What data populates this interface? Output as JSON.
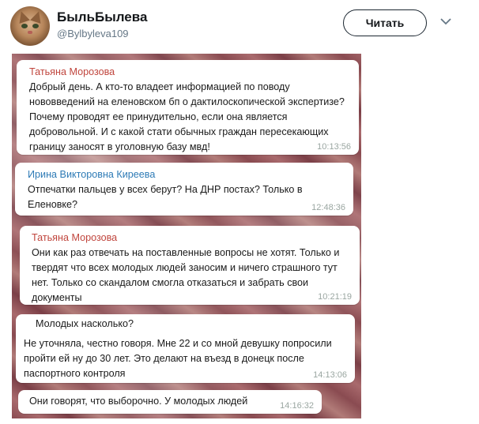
{
  "header": {
    "display_name": "БыльБылева",
    "handle": "@Bylbyleva109",
    "follow_label": "Читать"
  },
  "messages": [
    {
      "sender": "Татьяна Морозова",
      "text": "Добрый день. А кто-то владеет информацией по поводу нововведений на еленовском бп о дактилоскопической экспертизе? Почему проводят ее принудительно, если она является добровольной. И с какой стати обычных граждан пересекающих границу заносят в уголовную базу мвд!",
      "time": "10:13:56"
    },
    {
      "sender": "Ирина Викторовна Киреева",
      "text": "Отпечатки пальцев у всех берут? На ДНР постах? Только в Еленовке?",
      "time": "12:48:36"
    },
    {
      "sender": "Татьяна Морозова",
      "text": "Они как раз отвечать на поставленные вопросы не хотят. Только и твердят что всех молодых людей заносим и ничего страшного тут нет. Только со скандалом смогла отказаться и забрать свои документы",
      "time": "10:21:19"
    },
    {
      "quote": "Молодых насколько?",
      "text": "Не уточняла, честно говоря. Мне 22 и со мной девушку попросили пройти ей ну до 30 лет. Это делают на въезд в донецк после паспортного контроля",
      "time": "14:13:06"
    },
    {
      "text": "Они говорят, что выборочно. У молодых людей",
      "time": "14:16:32"
    }
  ]
}
